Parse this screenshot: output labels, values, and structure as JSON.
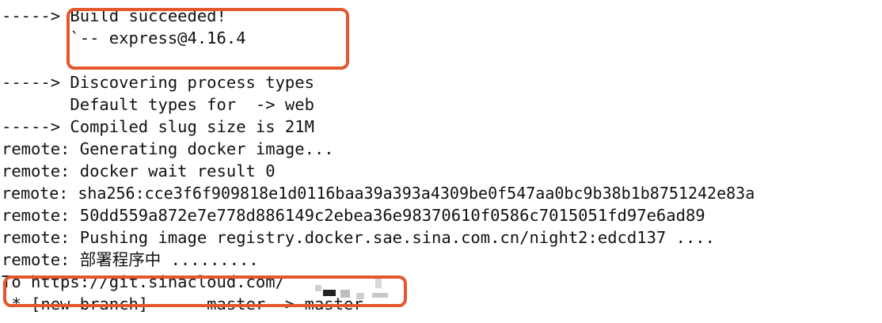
{
  "terminal": {
    "lines": [
      "-----> Build succeeded!",
      "       `-- express@4.16.4",
      "",
      "-----> Discovering process types",
      "       Default types for  -> web",
      "-----> Compiled slug size is 21M",
      "remote: Generating docker image...",
      "remote: docker wait result 0",
      "remote: sha256:cce3f6f909818e1d0116baa39a393a4309be0f547aa0bc9b38b1b8751242e83a",
      "remote: 50dd559a872e7e778d886149c2ebea36e98370610f0586c7015051fd97e6ad89",
      "remote: Pushing image registry.docker.sae.sina.com.cn/night2:edcd137 ....",
      "remote: 部署程序中 .........",
      "To https://git.sinacloud.com/",
      " * [new branch]      master -> master"
    ]
  },
  "annotations": {
    "color": "#e4572e"
  }
}
